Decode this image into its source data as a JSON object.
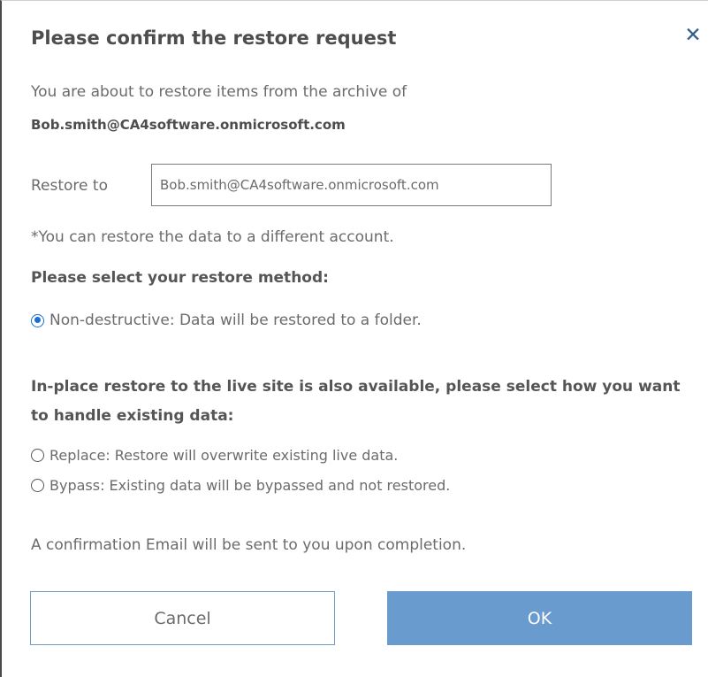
{
  "dialog": {
    "title": "Please confirm the restore request",
    "close_icon": "close-icon",
    "intro_text": "You are about to restore items from the archive of",
    "archive_account": "Bob.smith@CA4software.onmicrosoft.com",
    "restore_to_label": "Restore to",
    "restore_to_value": "Bob.smith@CA4software.onmicrosoft.com",
    "different_account_note": "*You can restore the data to a different account.",
    "method_title": "Please select your restore method:",
    "nondestructive_option": "Non-destructive: Data will be restored to a folder.",
    "inplace_title": "In-place restore to the live site is also available, please select how you want to handle existing data:",
    "replace_option": "Replace: Restore will overwrite existing live data.",
    "bypass_option": "Bypass: Existing data will be bypassed and not restored.",
    "confirmation_note": "A confirmation Email will be sent to you upon completion.",
    "cancel_label": "Cancel",
    "ok_label": "OK",
    "selected_method": "Non-destructive"
  },
  "colors": {
    "accent": "#6a9bcf",
    "close_icon": "#2f5f8a",
    "radio_selected": "#1a6fd6"
  }
}
